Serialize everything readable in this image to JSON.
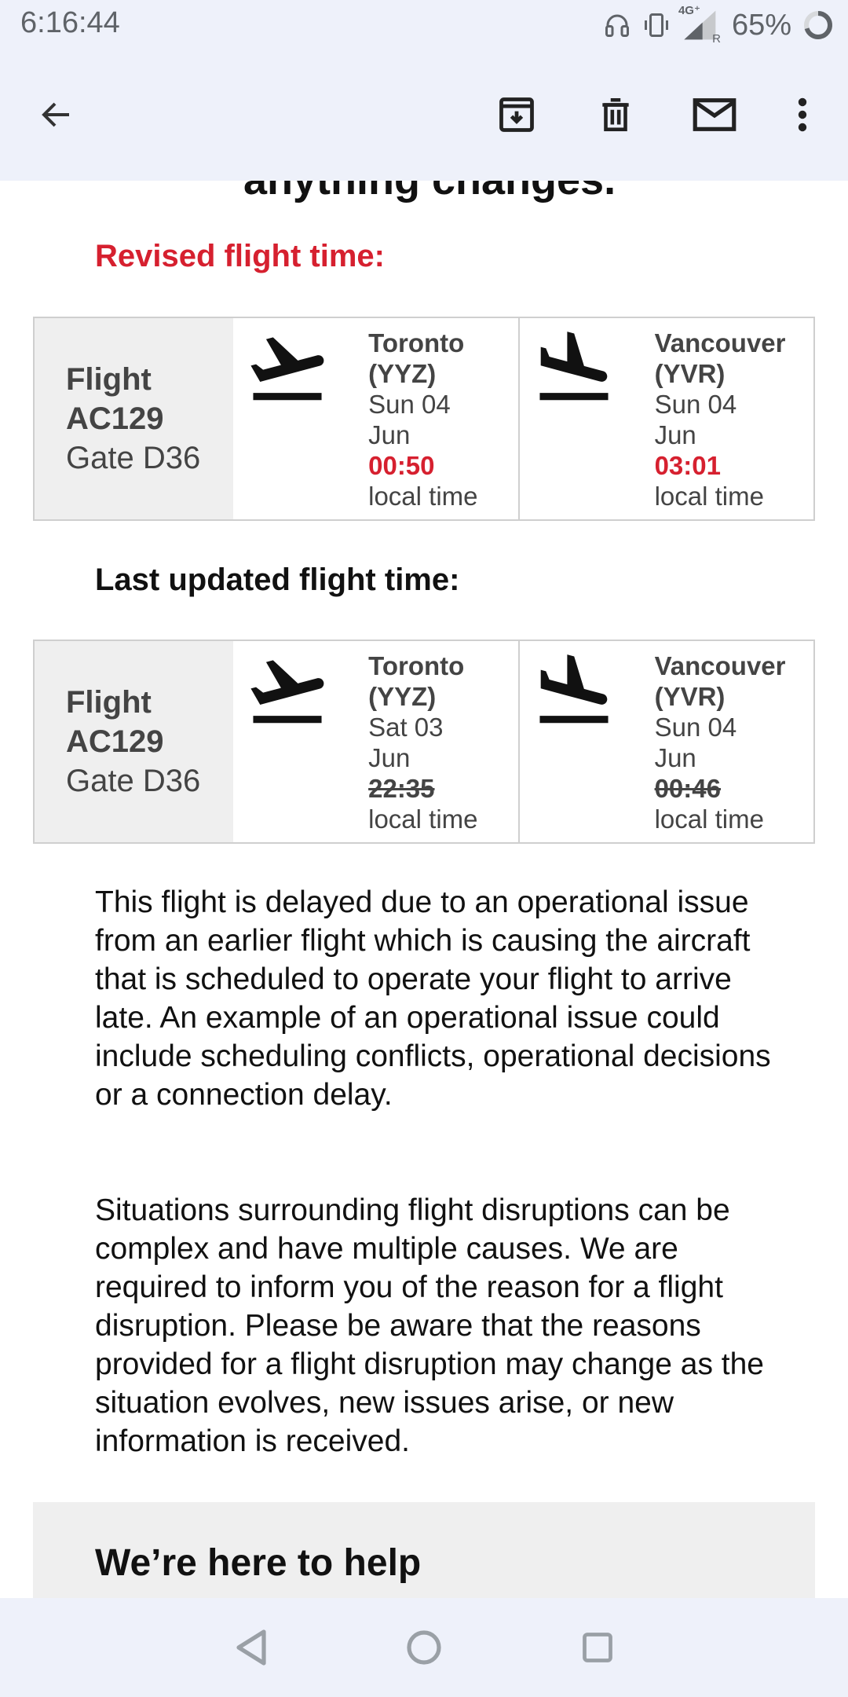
{
  "status_bar": {
    "time": "6:16:44",
    "network": "4G⁺",
    "roaming": "R",
    "battery": "65%"
  },
  "toolbar": {
    "back_icon": "arrow-left-icon",
    "archive_icon": "archive-icon",
    "delete_icon": "trash-icon",
    "mark_unread_icon": "mail-icon",
    "more_icon": "more-vert-icon"
  },
  "email": {
    "clipped_heading": "anything changes.",
    "revised_title": "Revised flight time:",
    "revised": {
      "flight_label": "Flight",
      "flight_number": "AC129",
      "gate": "Gate D36",
      "departure": {
        "city": "Toronto",
        "code": "(YYZ)",
        "date_line1": "Sun 04",
        "date_line2": "Jun",
        "time": "00:50",
        "time_note": "local time"
      },
      "arrival": {
        "city": "Vancouver",
        "code": "(YVR)",
        "date_line1": "Sun 04",
        "date_line2": "Jun",
        "time": "03:01",
        "time_note": "local time"
      }
    },
    "last_title": "Last updated flight time:",
    "last": {
      "flight_label": "Flight",
      "flight_number": "AC129",
      "gate": "Gate D36",
      "departure": {
        "city": "Toronto",
        "code": "(YYZ)",
        "date_line1": "Sat 03",
        "date_line2": "Jun",
        "time": "22:35",
        "time_note": "local time"
      },
      "arrival": {
        "city": "Vancouver",
        "code": "(YVR)",
        "date_line1": "Sun 04",
        "date_line2": "Jun",
        "time": "00:46",
        "time_note": "local time"
      }
    },
    "paragraph1": "This flight is delayed due to an operational issue from an earlier flight which is causing the aircraft that is scheduled to operate your flight to arrive late. An example of an operational issue could include scheduling conflicts, operational decisions or a connection delay.",
    "paragraph2": "Situations surrounding flight disruptions can be complex and have multiple causes. We are required to inform you of the reason for a flight disruption. Please be aware that the reasons provided for a flight disruption may change as the situation evolves, new issues arise, or new information is received.",
    "help_title": "We’re here to help"
  },
  "nav_bar": {
    "back_icon": "nav-back-icon",
    "home_icon": "nav-home-icon",
    "recents_icon": "nav-recents-icon"
  },
  "colors": {
    "accent_red": "#d6202f",
    "bar_background": "#eef1fa",
    "table_cell_gray": "#efefef"
  }
}
